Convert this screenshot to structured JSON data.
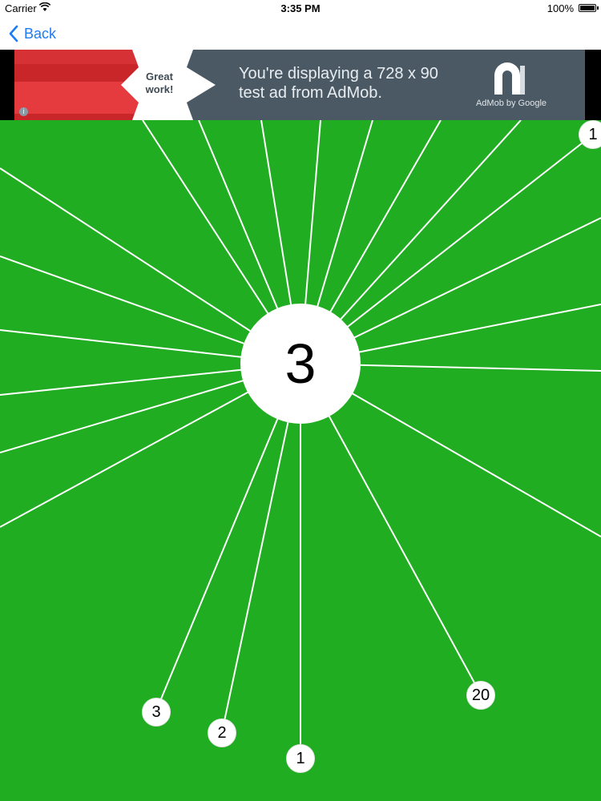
{
  "status_bar": {
    "carrier": "Carrier",
    "wifi_icon": "wifi-icon",
    "time": "3:35 PM",
    "battery_percent": "100%",
    "battery_icon": "battery-icon"
  },
  "nav": {
    "back_label": "Back",
    "back_icon": "chevron-left-icon",
    "accent_color": "#1a7cf5"
  },
  "ad": {
    "badge_line1": "Great",
    "badge_line2": "work!",
    "message_line1": "You're displaying a 728 x 90",
    "message_line2": "test ad from AdMob.",
    "brand": "AdMob by Google",
    "logo_icon": "admob-logo-icon",
    "info_icon": "info-icon",
    "info_glyph": "i"
  },
  "game": {
    "background_color": "#21ad21",
    "center_count": "3",
    "pins": [
      {
        "label": "3"
      },
      {
        "label": "2"
      },
      {
        "label": "1"
      },
      {
        "label": "20"
      },
      {
        "label": "1"
      }
    ],
    "unlabeled_pin_count": 17
  }
}
